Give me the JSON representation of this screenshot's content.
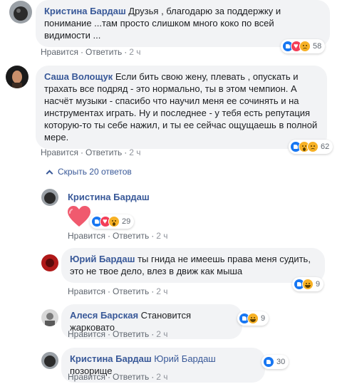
{
  "comments": [
    {
      "author": "Кристина Бардаш",
      "text": "Друзья , благодарю за поддержку и понимание ...там просто слишком много коко по всей видимости ...",
      "like": "Нравится",
      "reply": "Ответить",
      "time": "2 ч",
      "reactions": [
        "like-icon",
        "love-icon",
        "sad-icon"
      ],
      "count": "58"
    },
    {
      "author": "Саша Волощук",
      "text": "Если бить свою жену, плевать , опускать и трахать все подряд - это нормально, ты в этом чемпион. А насчёт музыки - спасибо что научил меня ее сочинять и на инструментах играть. Ну и последнее - у тебя есть репутация которую-то ты себе нажил, и ты ее сейчас ощущаешь в полной мере.",
      "like": "Нравится",
      "reply": "Ответить",
      "time": "2 ч",
      "reactions": [
        "like-icon",
        "wow-icon",
        "sad-icon"
      ],
      "count": "62"
    }
  ],
  "toggle": {
    "label": "Скрыть 20 ответов"
  },
  "replies": [
    {
      "author": "Кристина Бардаш",
      "sticker": "heart-sticker",
      "like": "Нравится",
      "reply": "Ответить",
      "time": "2 ч",
      "reactions": [
        "like-icon",
        "love-icon",
        "wow-icon"
      ],
      "count": "29"
    },
    {
      "author": "Юрий Бардаш",
      "text": "ты гнида не имеешь права меня судить, это не твое дело, влез в движ как мыша",
      "like": "Нравится",
      "reply": "Ответить",
      "time": "2 ч",
      "reactions": [
        "like-icon",
        "haha-icon"
      ],
      "count": "9"
    },
    {
      "author": "Алеся Барская",
      "text": "Становится жарковато",
      "like": "Нравится",
      "reply": "Ответить",
      "time": "2 ч",
      "reactions": [
        "like-icon",
        "haha-icon"
      ],
      "count": "9"
    },
    {
      "author": "Кристина Бардаш",
      "tag": "Юрий Бардаш",
      "text": "позорище",
      "like": "Нравится",
      "reply": "Ответить",
      "time": "2 ч",
      "reactions": [
        "like-icon"
      ],
      "count": "30"
    }
  ],
  "colors": {
    "name": "#385898",
    "bubble": "#f2f3f5",
    "meta": "#606770",
    "like": "#1877f2",
    "love": "#f33e58",
    "face": "#f7b125"
  }
}
